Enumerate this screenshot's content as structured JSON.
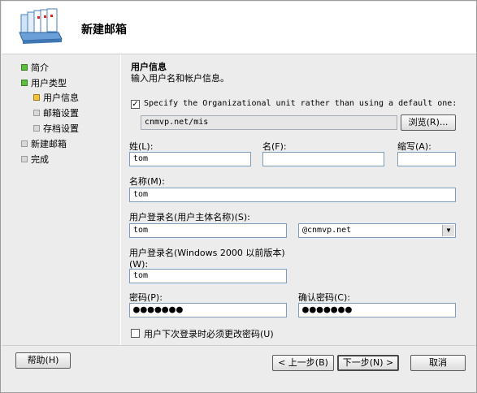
{
  "header": {
    "title": "新建邮箱"
  },
  "sidebar": {
    "items": [
      {
        "label": "简介"
      },
      {
        "label": "用户类型"
      },
      {
        "label": "用户信息"
      },
      {
        "label": "邮箱设置"
      },
      {
        "label": "存档设置"
      },
      {
        "label": "新建邮箱"
      },
      {
        "label": "完成"
      }
    ]
  },
  "content": {
    "title": "用户信息",
    "subtitle": "输入用户名和帐户信息。",
    "ou_checkbox_label": "Specify the Organizational unit rather than using a default one:",
    "ou_value": "cnmvp.net/mis",
    "browse_label": "浏览(R)...",
    "last_name_label": "姓(L):",
    "last_name_value": "tom",
    "first_name_label": "名(F):",
    "first_name_value": "",
    "initials_label": "缩写(A):",
    "initials_value": "",
    "name_label": "名称(M):",
    "name_value": "tom",
    "upn_label": "用户登录名(用户主体名称)(S):",
    "upn_value": "tom",
    "upn_domain": "@cnmvp.net",
    "pre2000_label_1": "用户登录名(Windows 2000 以前版本)",
    "pre2000_label_2": "(W):",
    "pre2000_value": "tom",
    "password_label": "密码(P):",
    "password_value": "●●●●●●●",
    "confirm_label": "确认密码(C):",
    "confirm_value": "●●●●●●●",
    "change_pw_label": "用户下次登录时必须更改密码(U)"
  },
  "footer": {
    "help": "帮助(H)",
    "back": "< 上一步(B)",
    "next": "下一步(N) >",
    "cancel": "取消"
  }
}
